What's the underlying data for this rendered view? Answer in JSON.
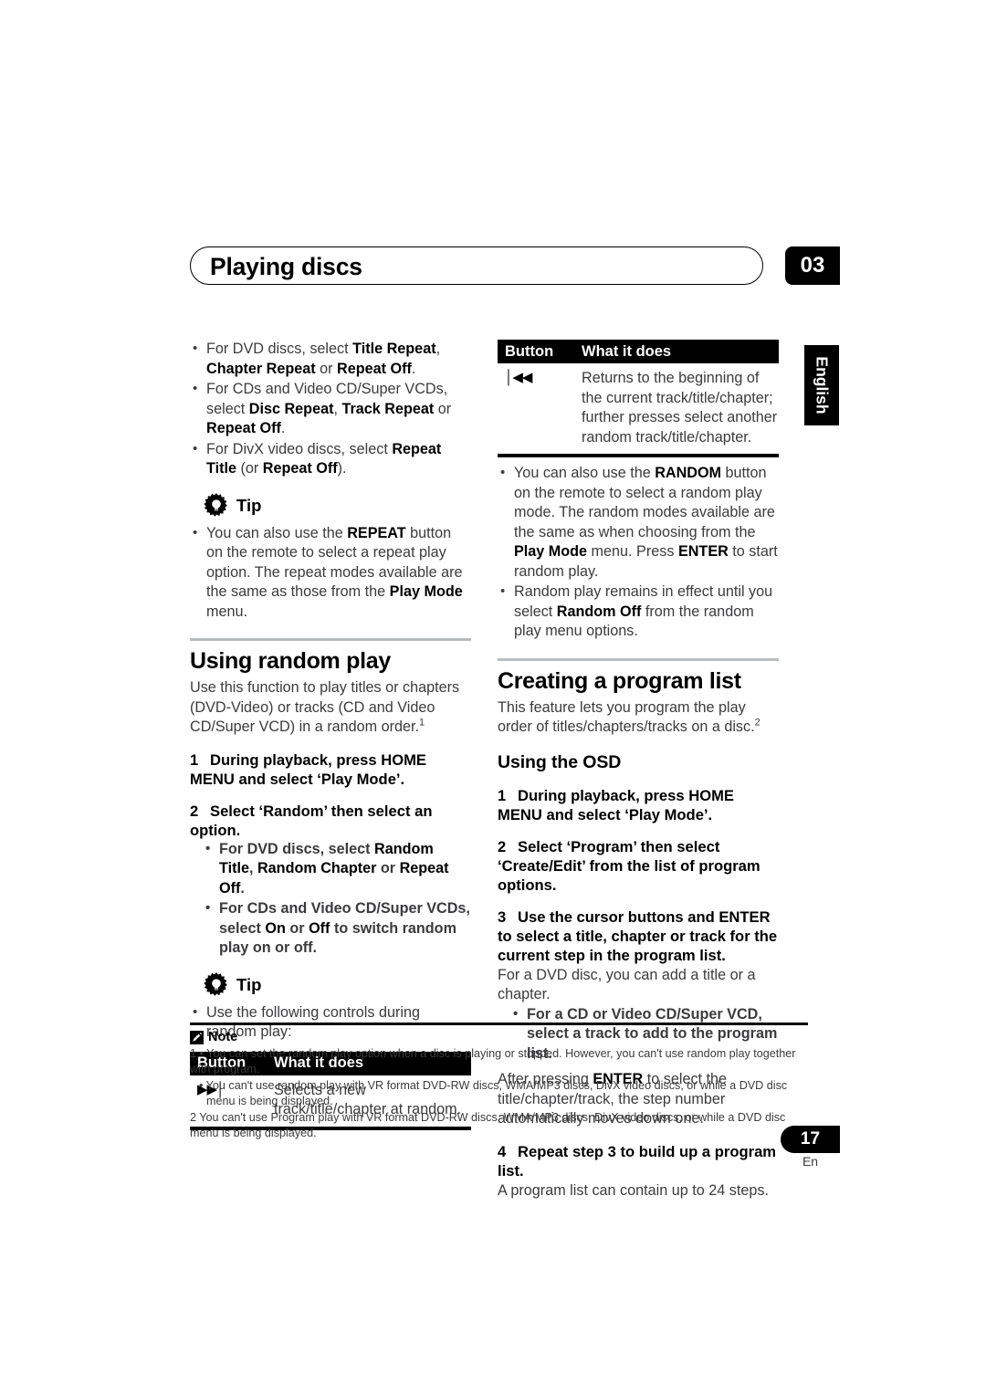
{
  "header": {
    "title": "Playing discs",
    "chapter": "03",
    "language_tab": "English"
  },
  "left_column": {
    "repeat_options": [
      "For DVD discs, select <b>Title Repeat</b>, <b>Chapter Repeat</b> or <b>Repeat Off</b>.",
      "For CDs and Video CD/Super VCDs, select <b>Disc Repeat</b>, <b>Track Repeat</b> or <b>Repeat Off</b>.",
      "For DivX video discs, select <b>Repeat Title</b> (or <b>Repeat Off</b>)."
    ],
    "tip1": {
      "label": "Tip",
      "icon": "gear-bulb-icon",
      "items": [
        "You can also use the <b>REPEAT</b> button on the remote to select a repeat play option. The repeat modes available are the same as those from the <b>Play Mode</b> menu."
      ]
    },
    "random_section": {
      "title": "Using random play",
      "intro": "Use this function to play titles or chapters (DVD-Video) or tracks (CD and Video CD/Super VCD) in a random order.<sup class=\"sup\">1</sup>",
      "steps": [
        {
          "num": "1",
          "text": "During playback, press HOME MENU and select ‘Play Mode’.",
          "bullets": []
        },
        {
          "num": "2",
          "text": "Select ‘Random’ then select an option.",
          "bullets": [
            "For DVD discs, select <b>Random Title</b>, <b>Random Chapter</b> or <b>Repeat Off</b>.",
            "For CDs and Video CD/Super VCDs, select <b>On</b> or <b>Off</b> to switch random play on or off."
          ]
        }
      ]
    },
    "tip2": {
      "label": "Tip",
      "icon": "gear-bulb-icon",
      "items": [
        "Use the following controls during random play:"
      ]
    },
    "button_table": {
      "headers": [
        "Button",
        "What it does"
      ],
      "rows": [
        {
          "button_glyph": "▶▶│",
          "button_icon": "next-track-icon",
          "description": "Selects a new track/title/chapter at random."
        }
      ]
    }
  },
  "right_column": {
    "button_table": {
      "headers": [
        "Button",
        "What it does"
      ],
      "rows": [
        {
          "button_glyph": "│◀◀",
          "button_icon": "previous-track-icon",
          "description": "Returns to the beginning of the current track/title/chapter; further presses select another random track/title/chapter."
        }
      ]
    },
    "random_notes": [
      "You can also use the <b>RANDOM</b> button on the remote to select a random play mode. The random modes available are the same as when choosing from the <b>Play Mode</b> menu. Press <b>ENTER</b> to start random play.",
      "Random play remains in effect until you select <b>Random Off</b> from the random play menu options."
    ],
    "program_section": {
      "title": "Creating a program list",
      "intro": "This feature lets you program the play order of titles/chapters/tracks on a disc.<sup class=\"sup\">2</sup>",
      "subtitle": "Using the OSD",
      "steps": [
        {
          "num": "1",
          "text": "During playback, press HOME MENU and select ‘Play Mode’.",
          "body": "",
          "bullets": [],
          "after": ""
        },
        {
          "num": "2",
          "text": "Select ‘Program’ then select ‘Create/Edit’ from the list of program options.",
          "body": "",
          "bullets": [],
          "after": ""
        },
        {
          "num": "3",
          "text": "Use the cursor buttons and ENTER to select a title, chapter or track for the current step in the program list.",
          "body": "For a DVD disc, you can add a title or a chapter.",
          "bullets": [
            "For a CD or Video CD/Super VCD, select a track to add to the program list."
          ],
          "after": "After pressing <b>ENTER</b> to select the title/chapter/track, the step number automatically moves down one."
        },
        {
          "num": "4",
          "text": "Repeat step 3 to build up a program list.",
          "body": "A program list can contain up to 24 steps.",
          "bullets": [],
          "after": ""
        }
      ]
    }
  },
  "notes": {
    "icon": "pencil-note-icon",
    "label": "Note",
    "footnotes": [
      "1 • You can set the random play option when a disc is playing or stopped. However, you can't use random play together with program.",
      "• You can't use random play with VR format DVD-RW discs, WMA/MP3 discs, DivX video discs, or while a DVD disc menu is being displayed.",
      "2 You can't use Program play with VR format DVD-RW discs, WMA/MP3 discs, DivX video discs, or while a DVD disc menu is being displayed."
    ]
  },
  "footer": {
    "page_number": "17",
    "language_code": "En"
  }
}
